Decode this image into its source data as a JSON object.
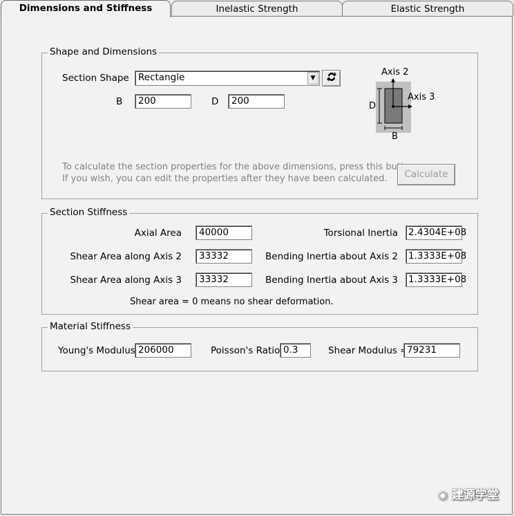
{
  "tabs": [
    {
      "label": "Dimensions and Stiffness"
    },
    {
      "label": "Inelastic Strength"
    },
    {
      "label": "Elastic Strength"
    }
  ],
  "shape_group": {
    "title": "Shape and Dimensions",
    "section_shape_label": "Section Shape",
    "section_shape_value": "Rectangle",
    "b_label": "B",
    "b_value": "200",
    "d_label": "D",
    "d_value": "200",
    "diagram": {
      "axis2": "Axis 2",
      "axis3": "Axis 3",
      "d": "D",
      "b": "B"
    },
    "hint_line1": "To calculate the section properties for the above dimensions, press this button.",
    "hint_line2": "If you wish, you can edit the properties after they have been calculated.",
    "calculate_label": "Calculate"
  },
  "stiffness_group": {
    "title": "Section Stiffness",
    "axial_area_label": "Axial Area",
    "axial_area_value": "40000",
    "shear_area_2_label": "Shear Area along Axis 2",
    "shear_area_2_value": "33332",
    "shear_area_3_label": "Shear Area along Axis 3",
    "shear_area_3_value": "33332",
    "torsional_label": "Torsional Inertia",
    "torsional_value": "2.4304E+08",
    "bending_2_label": "Bending Inertia about Axis 2",
    "bending_2_value": "1.3333E+08",
    "bending_3_label": "Bending Inertia about Axis 3",
    "bending_3_value": "1.3333E+08",
    "note": "Shear area = 0 means no shear deformation."
  },
  "material_group": {
    "title": "Material Stiffness",
    "youngs_label": "Young's Modulus",
    "youngs_value": "206000",
    "poisson_label": "Poisson's Ratio",
    "poisson_value": "0.3",
    "shear_modulus_label": "Shear Modulus =",
    "shear_modulus_value": "79231"
  },
  "watermark": "建源学堂"
}
